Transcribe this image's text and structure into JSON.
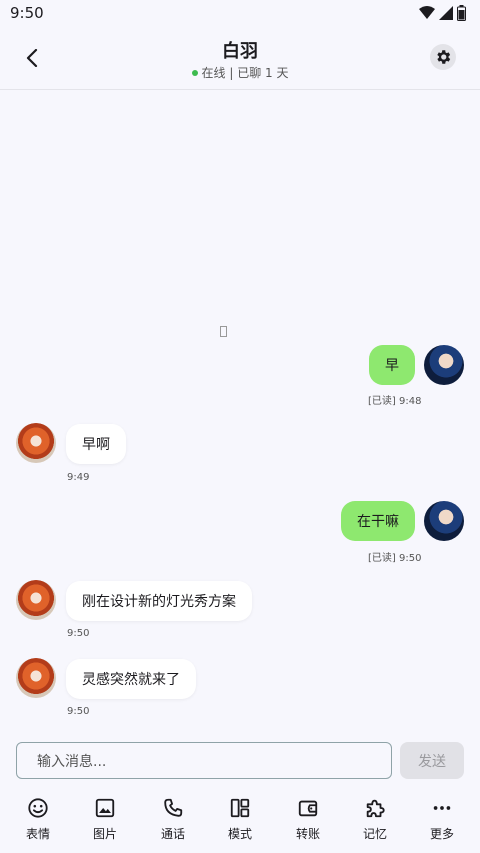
{
  "status_bar": {
    "time": "9:50"
  },
  "header": {
    "title": "白羽",
    "status": "在线 | 已聊 1 天"
  },
  "messages": [
    {
      "sender": "me",
      "text": "早",
      "time": "[已读] 9:48"
    },
    {
      "sender": "bot",
      "text": "早啊",
      "time": "9:49"
    },
    {
      "sender": "me",
      "text": "在干嘛",
      "time": "[已读] 9:50"
    },
    {
      "sender": "bot",
      "text": "刚在设计新的灯光秀方案",
      "time": "9:50"
    },
    {
      "sender": "bot",
      "text": "灵感突然就来了",
      "time": "9:50"
    }
  ],
  "composer": {
    "placeholder": "输入消息...",
    "send_label": "发送"
  },
  "toolbar": [
    {
      "label": "表情",
      "icon": "emoji-icon"
    },
    {
      "label": "图片",
      "icon": "image-icon"
    },
    {
      "label": "通话",
      "icon": "phone-icon"
    },
    {
      "label": "模式",
      "icon": "layout-icon"
    },
    {
      "label": "转账",
      "icon": "wallet-icon"
    },
    {
      "label": "记忆",
      "icon": "puzzle-icon"
    },
    {
      "label": "更多",
      "icon": "more-icon"
    }
  ],
  "colors": {
    "accent_bubble": "#8ee86f",
    "online_dot": "#3dbb4f"
  }
}
